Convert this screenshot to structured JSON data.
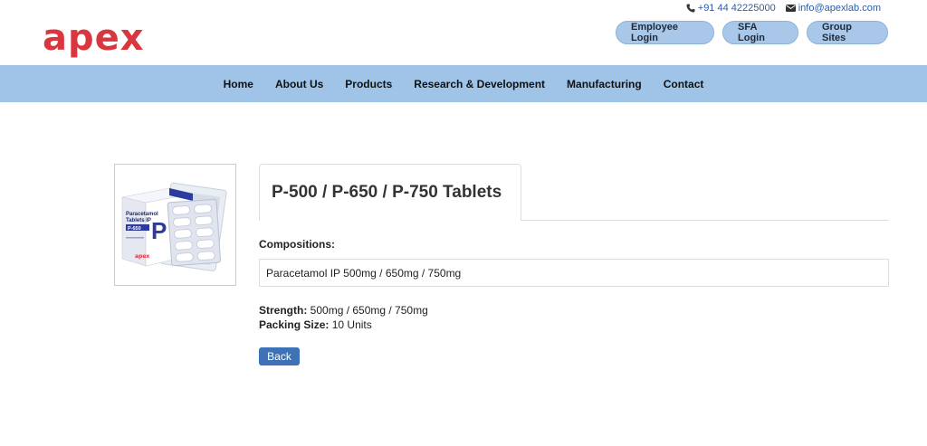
{
  "brand": {
    "logo_text": "apex",
    "logo_color": "#d9363e"
  },
  "contact": {
    "phone": "+91 44 42225000",
    "email": "info@apexlab.com"
  },
  "header_buttons": [
    "Employee Login",
    "SFA Login",
    "Group Sites"
  ],
  "nav": [
    "Home",
    "About Us",
    "Products",
    "Research & Development",
    "Manufacturing",
    "Contact"
  ],
  "product": {
    "title": "P-500 / P-650 / P-750 Tablets",
    "compositions_label": "Compositions:",
    "compositions_value": "Paracetamol IP 500mg / 650mg / 750mg",
    "strength_label": "Strength:",
    "strength_value": "500mg / 650mg / 750mg",
    "packing_label": "Packing Size:",
    "packing_value": "10 Units",
    "back_label": "Back",
    "image": {
      "box_name_line1": "Paracetamol",
      "box_name_line2": "Tablets IP",
      "box_badge": "P-650",
      "box_letter": "P",
      "box_brand": "apex"
    }
  },
  "colors": {
    "nav_bg": "#9fc4e8",
    "pill_bg": "#a9c7e8",
    "button_blue": "#3d72b6",
    "link_blue": "#2a5db0",
    "box_blue": "#2c3b9c"
  }
}
